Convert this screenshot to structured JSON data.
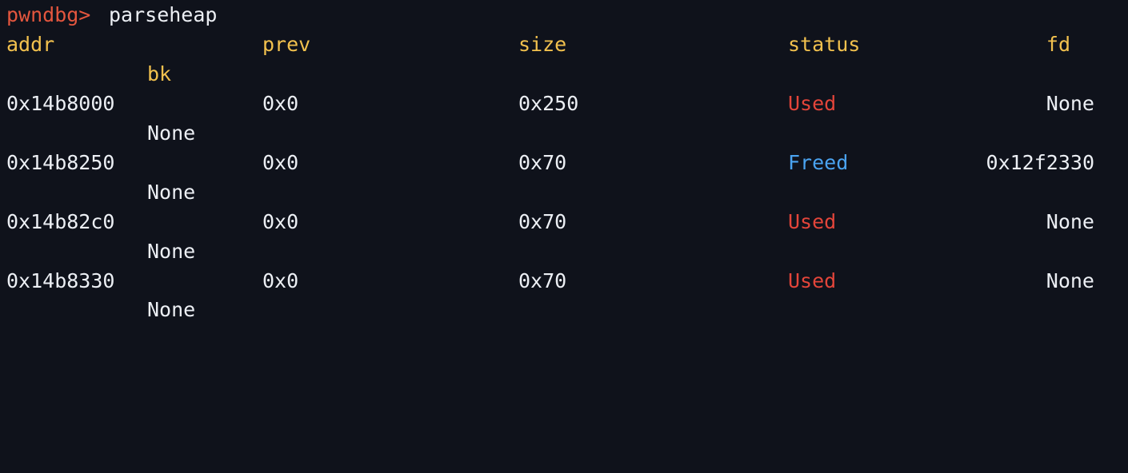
{
  "prompt": "pwndbg>",
  "command": "parseheap",
  "headers": {
    "addr": "addr",
    "prev": "prev",
    "size": "size",
    "status": "status",
    "fd": "fd",
    "bk": "bk"
  },
  "rows": [
    {
      "addr": "0x14b8000",
      "prev": "0x0",
      "size": "0x250",
      "status": "Used",
      "fd": "None",
      "bk": "None"
    },
    {
      "addr": "0x14b8250",
      "prev": "0x0",
      "size": "0x70",
      "status": "Freed",
      "fd": "0x12f2330",
      "bk": "None"
    },
    {
      "addr": "0x14b82c0",
      "prev": "0x0",
      "size": "0x70",
      "status": "Used",
      "fd": "None",
      "bk": "None"
    },
    {
      "addr": "0x14b8330",
      "prev": "0x0",
      "size": "0x70",
      "status": "Used",
      "fd": "None",
      "bk": "None"
    }
  ],
  "colors": {
    "background": "#0f121b",
    "prompt": "#e4563e",
    "header": "#f2c14e",
    "used": "#e3453a",
    "freed": "#4aa3f0",
    "text": "#eceff4"
  }
}
